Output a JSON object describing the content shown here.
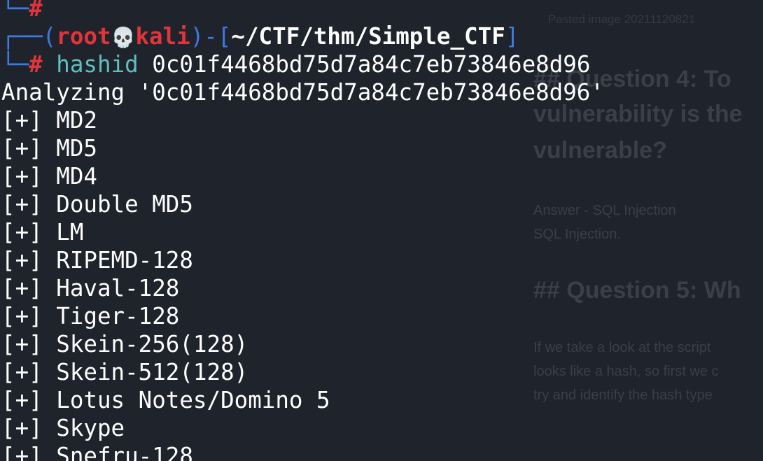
{
  "background_doc": {
    "caption": "Pasted image 20211120821",
    "heading_q4_line1": "## Question 4: To",
    "heading_q4_line2": "vulnerability is the",
    "heading_q4_line3": "vulnerable?",
    "answer_line1": "Answer          - SQL Injection",
    "answer_line2": "SQL Injection.",
    "heading_q5": "## Question 5: Wh",
    "para_line1": "If we take a look at the script",
    "para_line2": "looks like a hash, so first we c",
    "para_line3": "try and identify the hash type"
  },
  "prompt": {
    "corner_top": "└─",
    "hash_symbol": "#",
    "frame_open": "┌──(",
    "user": "root",
    "skull_glyph": "💀",
    "host": "kali",
    "frame_mid": ")-[",
    "cwd": "~/CTF/thm/Simple_CTF",
    "frame_close": "]",
    "corner_bottom": "└─",
    "command": "hashid",
    "argument": " 0c01f4468bd75d7a84c7eb73846e8d96"
  },
  "output": {
    "analyzing": "Analyzing '0c01f4468bd75d7a84c7eb73846e8d96'",
    "results": [
      "[+] MD2",
      "[+] MD5",
      "[+] MD4",
      "[+] Double MD5",
      "[+] LM",
      "[+] RIPEMD-128",
      "[+] Haval-128",
      "[+] Tiger-128",
      "[+] Skein-256(128)",
      "[+] Skein-512(128)",
      "[+] Lotus Notes/Domino 5",
      "[+] Skype",
      "[+] Snefru-128"
    ]
  },
  "colors": {
    "background": "#1f232b",
    "prompt_frame": "#3e7be1",
    "prompt_user": "#e0353b",
    "command": "#5fbfc0",
    "text": "#ffffff"
  }
}
